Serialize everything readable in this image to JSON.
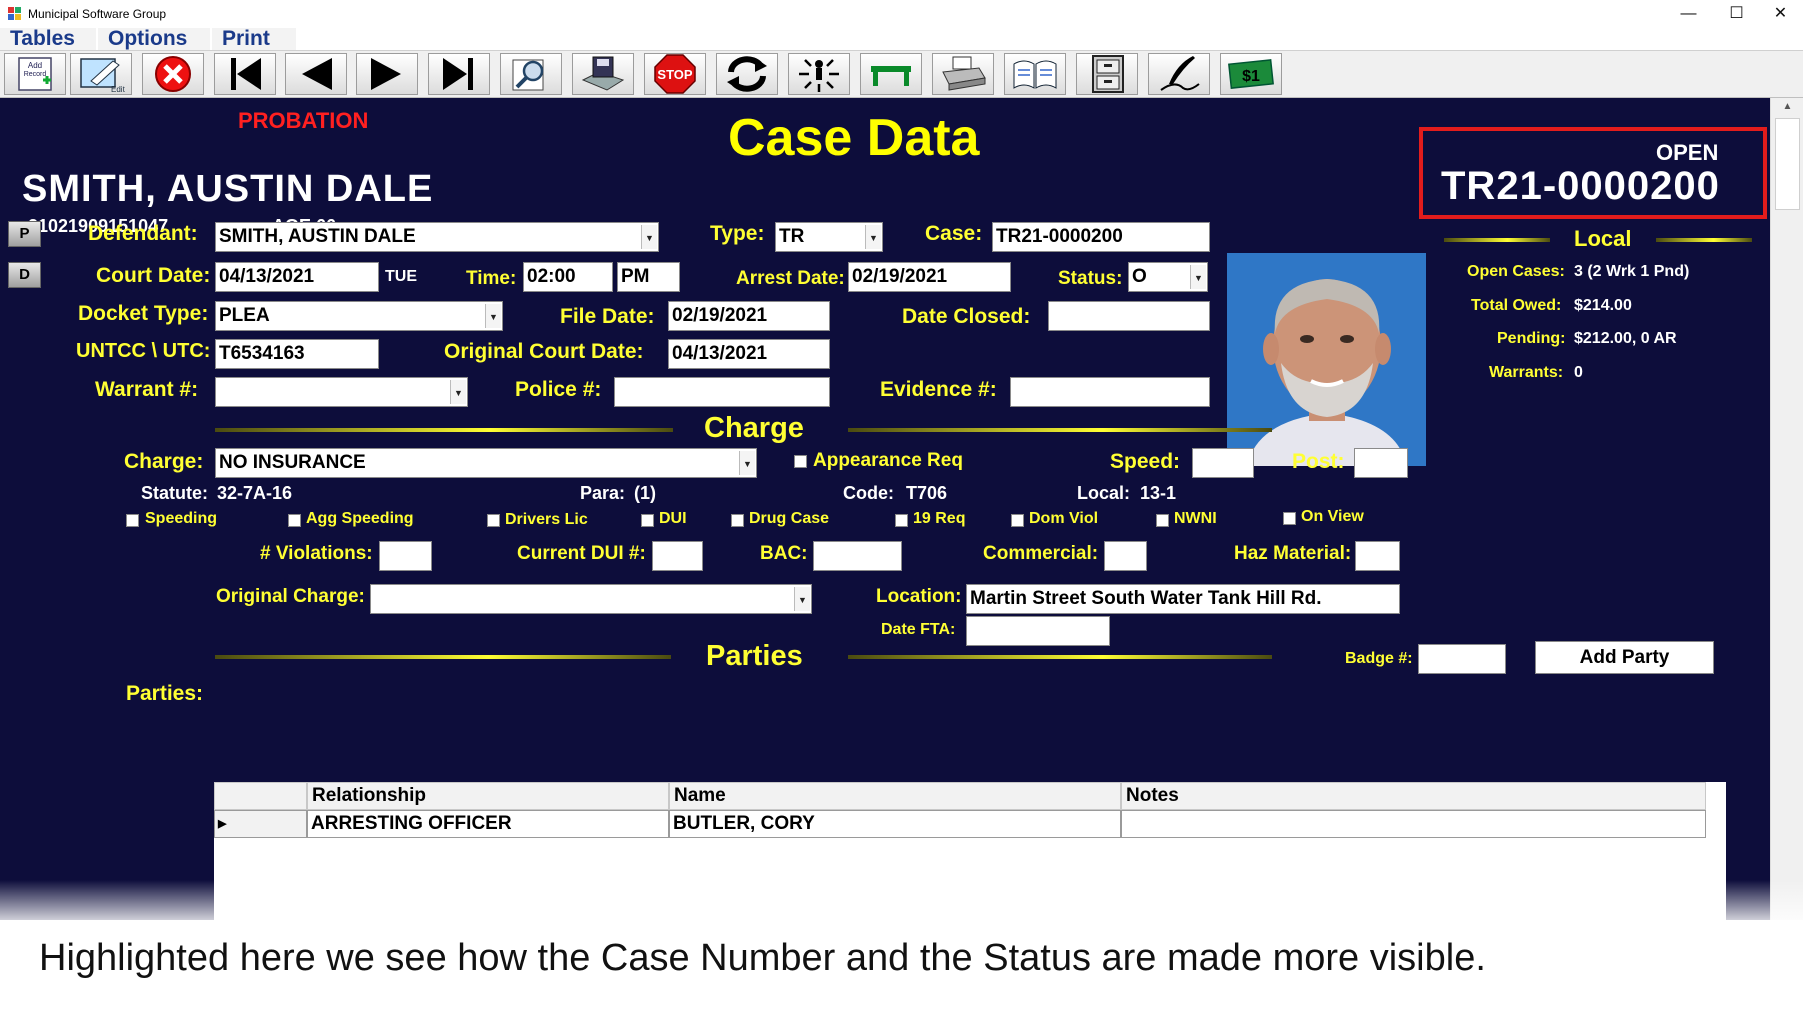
{
  "window": {
    "title": "Municipal Software Group",
    "minimize": "—",
    "maximize": "☐",
    "close": "✕"
  },
  "menu": [
    {
      "label": "Tables"
    },
    {
      "label": "Options"
    },
    {
      "label": "Print"
    }
  ],
  "toolbar": {
    "add_record_label": "Add Record",
    "edit_label": "Edit"
  },
  "header": {
    "probation": "PROBATION",
    "title": "Case Data",
    "defendant_name": "SMITH, AUSTIN DALE",
    "defendant_id": "21021909151047",
    "age": "AGE  66",
    "status": "OPEN",
    "case_number": "TR21-0000200"
  },
  "side_buttons": {
    "p": "P",
    "d": "D"
  },
  "form": {
    "defendant_label": "Defendant:",
    "defendant_value": "SMITH, AUSTIN DALE",
    "type_label": "Type:",
    "type_value": "TR",
    "case_label": "Case:",
    "case_value": "TR21-0000200",
    "court_date_label": "Court Date:",
    "court_date_value": "04/13/2021",
    "court_day": "TUE",
    "time_label": "Time:",
    "time_value": "02:00",
    "ampm_value": "PM",
    "arrest_date_label": "Arrest Date:",
    "arrest_date_value": "02/19/2021",
    "status_label": "Status:",
    "status_value": "O",
    "docket_type_label": "Docket Type:",
    "docket_type_value": "PLEA",
    "file_date_label": "File Date:",
    "file_date_value": "02/19/2021",
    "date_closed_label": "Date Closed:",
    "date_closed_value": "",
    "untcc_label": "UNTCC \\ UTC:",
    "untcc_value": "T6534163",
    "original_court_date_label": "Original Court Date:",
    "original_court_date_value": "04/13/2021",
    "warrant_label": "Warrant #:",
    "warrant_value": "",
    "police_label": "Police #:",
    "police_value": "",
    "evidence_label": "Evidence #:",
    "evidence_value": ""
  },
  "local": {
    "title": "Local",
    "open_cases_label": "Open Cases:",
    "open_cases_value": "3 (2 Wrk  1 Pnd)",
    "total_owed_label": "Total Owed:",
    "total_owed_value": "$214.00",
    "pending_label": "Pending:",
    "pending_value": "$212.00,  0 AR",
    "warrants_label": "Warrants:",
    "warrants_value": "0"
  },
  "charge": {
    "section_title": "Charge",
    "charge_label": "Charge:",
    "charge_value": "NO INSURANCE",
    "appearance_req_label": "Appearance Req",
    "speed_label": "Speed:",
    "speed_value": "",
    "post_label": "Post:",
    "post_value": "",
    "statute_label": "Statute:",
    "statute_value": "32-7A-16",
    "para_label": "Para:",
    "para_value": "(1)",
    "code_label": "Code:",
    "code_value": "T706",
    "local_label": "Local:",
    "local_value": "13-1",
    "checkboxes": {
      "speeding": "Speeding",
      "agg_speeding": "Agg Speeding",
      "drivers_lic": "Drivers Lic",
      "dui": "DUI",
      "drug_case": "Drug Case",
      "req19": "19 Req",
      "dom_viol": "Dom Viol",
      "nwni": "NWNI",
      "on_view": "On View"
    },
    "violations_label": "# Violations:",
    "violations_value": "",
    "current_dui_label": "Current DUI #:",
    "current_dui_value": "",
    "bac_label": "BAC:",
    "bac_value": "",
    "commercial_label": "Commercial:",
    "commercial_value": "",
    "haz_material_label": "Haz Material:",
    "haz_material_value": "",
    "original_charge_label": "Original Charge:",
    "original_charge_value": "",
    "location_label": "Location:",
    "location_value": "Martin Street South   Water Tank Hill Rd.",
    "date_fta_label": "Date FTA:",
    "date_fta_value": ""
  },
  "parties": {
    "section_title": "Parties",
    "badge_label": "Badge #:",
    "badge_value": "",
    "add_party_label": "Add Party",
    "parties_label": "Parties:",
    "columns": [
      "Relationship",
      "Name",
      "Notes"
    ],
    "rows": [
      {
        "relationship": "ARRESTING OFFICER",
        "name": "BUTLER, CORY",
        "notes": ""
      }
    ]
  },
  "caption": "Highlighted here we see how the Case Number and the Status are made more visible.",
  "colors": {
    "background": "#0d0d3b",
    "label": "#ffff33",
    "highlight": "#e21c1c",
    "probation": "#ff2020"
  }
}
